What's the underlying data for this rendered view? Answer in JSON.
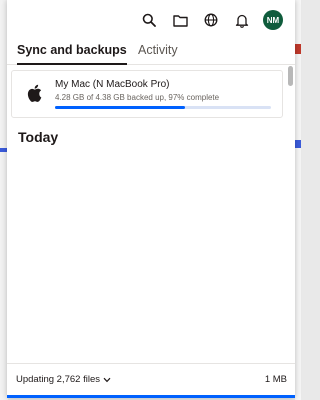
{
  "header": {
    "icons": [
      "search-icon",
      "folder-icon",
      "globe-icon",
      "bell-icon"
    ],
    "avatar_initials": "NM",
    "avatar_color": "#0f5c3c"
  },
  "tabs": [
    {
      "label": "Sync and backups",
      "active": true
    },
    {
      "label": "Activity",
      "active": false
    }
  ],
  "backup": {
    "device_name": "My Mac (N              MacBook Pro)",
    "status": "4.28 GB of 4.38 GB backed up, 97% complete",
    "progress_fraction": 0.6,
    "icon": "apple-icon"
  },
  "section_title": "Today",
  "footer": {
    "status": "Updating 2,762 files",
    "size": "1 MB"
  },
  "colors": {
    "accent": "#0061fe",
    "text": "#1e1919"
  }
}
